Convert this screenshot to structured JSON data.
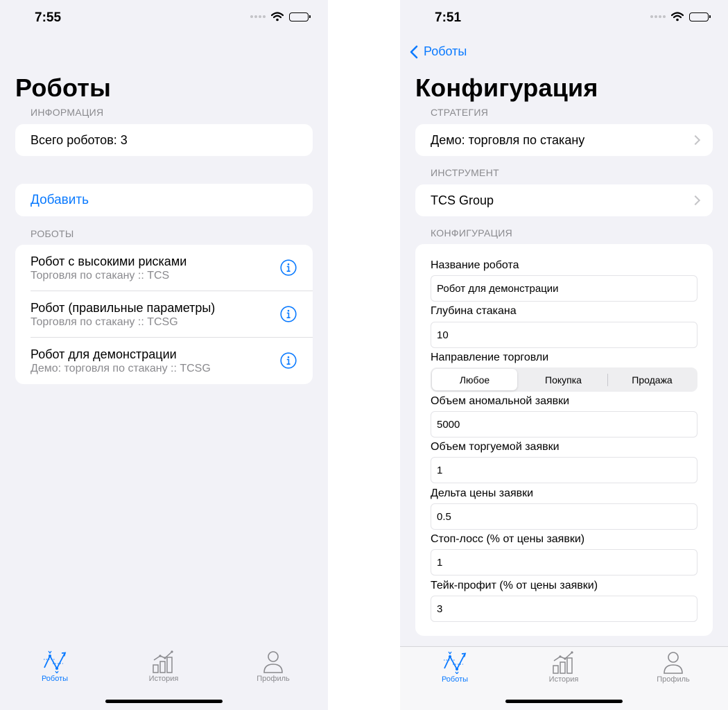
{
  "left_screen": {
    "status_time": "7:55",
    "title": "Роботы",
    "info_header": "ИНФОРМАЦИЯ",
    "total_label": "Всего роботов: 3",
    "add_label": "Добавить",
    "robots_header": "РОБОТЫ",
    "robots": [
      {
        "name": "Робот с высокими рисками",
        "subtitle": "Торговля по стакану :: TCS"
      },
      {
        "name": "Робот (правильные параметры)",
        "subtitle": "Торговля по стакану :: TCSG"
      },
      {
        "name": "Робот для демонстрации",
        "subtitle": "Демо: торговля по стакану :: TCSG"
      }
    ]
  },
  "right_screen": {
    "status_time": "7:51",
    "back_label": "Роботы",
    "title": "Конфигурация",
    "strategy_header": "СТРАТЕГИЯ",
    "strategy_value": "Демо: торговля по стакану",
    "instrument_header": "ИНСТРУМЕНТ",
    "instrument_value": "TCS Group",
    "config_header": "КОНФИГУРАЦИЯ",
    "fields": [
      {
        "label": "Название робота",
        "value": "Робот для демонстрации"
      },
      {
        "label": "Глубина стакана",
        "value": "10"
      }
    ],
    "direction": {
      "label": "Направление торговли",
      "options": [
        "Любое",
        "Покупка",
        "Продажа"
      ],
      "selected": "Любое"
    },
    "fields2": [
      {
        "label": "Объем аномальной заявки",
        "value": "5000"
      },
      {
        "label": "Объем торгуемой заявки",
        "value": "1"
      },
      {
        "label": "Дельта цены заявки",
        "value": "0.5"
      },
      {
        "label": "Стоп-лосс (% от цены заявки)",
        "value": "1"
      },
      {
        "label": "Тейк-профит (% от цены заявки)",
        "value": "3"
      }
    ]
  },
  "tabbar": {
    "tabs": [
      {
        "label": "Роботы",
        "icon": "robots-chart-icon",
        "active": true
      },
      {
        "label": "История",
        "icon": "history-bars-icon",
        "active": false
      },
      {
        "label": "Профиль",
        "icon": "profile-person-icon",
        "active": false
      }
    ]
  },
  "colors": {
    "accent": "#0a7aff",
    "background": "#f2f2f7",
    "secondary_text": "#8a8a8e"
  }
}
